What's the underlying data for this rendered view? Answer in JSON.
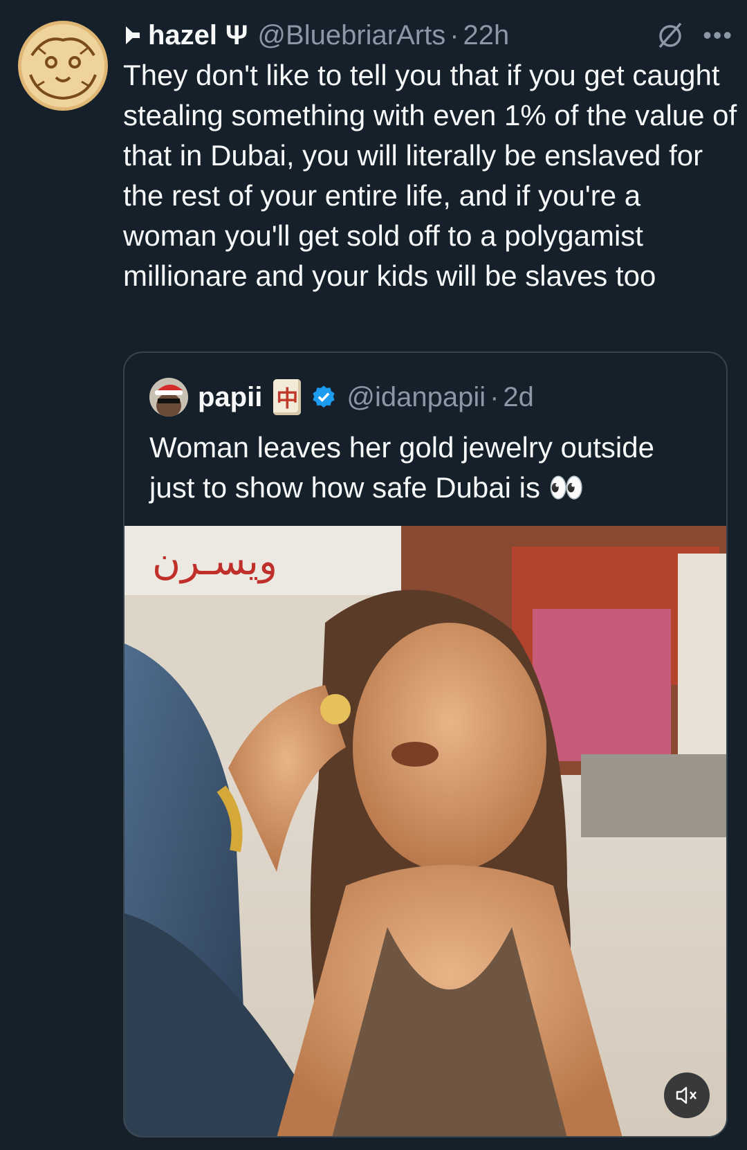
{
  "tweet": {
    "author_name": "hazel",
    "name_symbol": "Ψ",
    "handle": "@BluebriarArts",
    "separator": "·",
    "time": "22h",
    "text": "They don't like to tell you that if you get caught stealing something with even 1% of the value of that in Dubai, you will literally be enslaved for the rest of your entire life, and if you're a woman you'll get sold off to a polygamist millionare and your kids will be slaves too",
    "more_label": "•••"
  },
  "quote": {
    "author_name": "papii",
    "badge_glyph": "中",
    "handle": "@idanpapii",
    "separator": "·",
    "time": "2d",
    "text": "Woman leaves her gold jewelry outside just to show how safe Dubai is 👀",
    "media_sign_text": "ويسـرن"
  },
  "colors": {
    "background": "#15202b",
    "text": "#f7f9f9",
    "secondary": "#8b98a5",
    "verified": "#1d9bf0",
    "border": "#38444d"
  },
  "icons": {
    "grok": "grok-icon",
    "more": "more-icon",
    "verified": "verified-badge-icon",
    "mute": "mute-speaker-icon",
    "pin": "arrow-pin-icon"
  }
}
